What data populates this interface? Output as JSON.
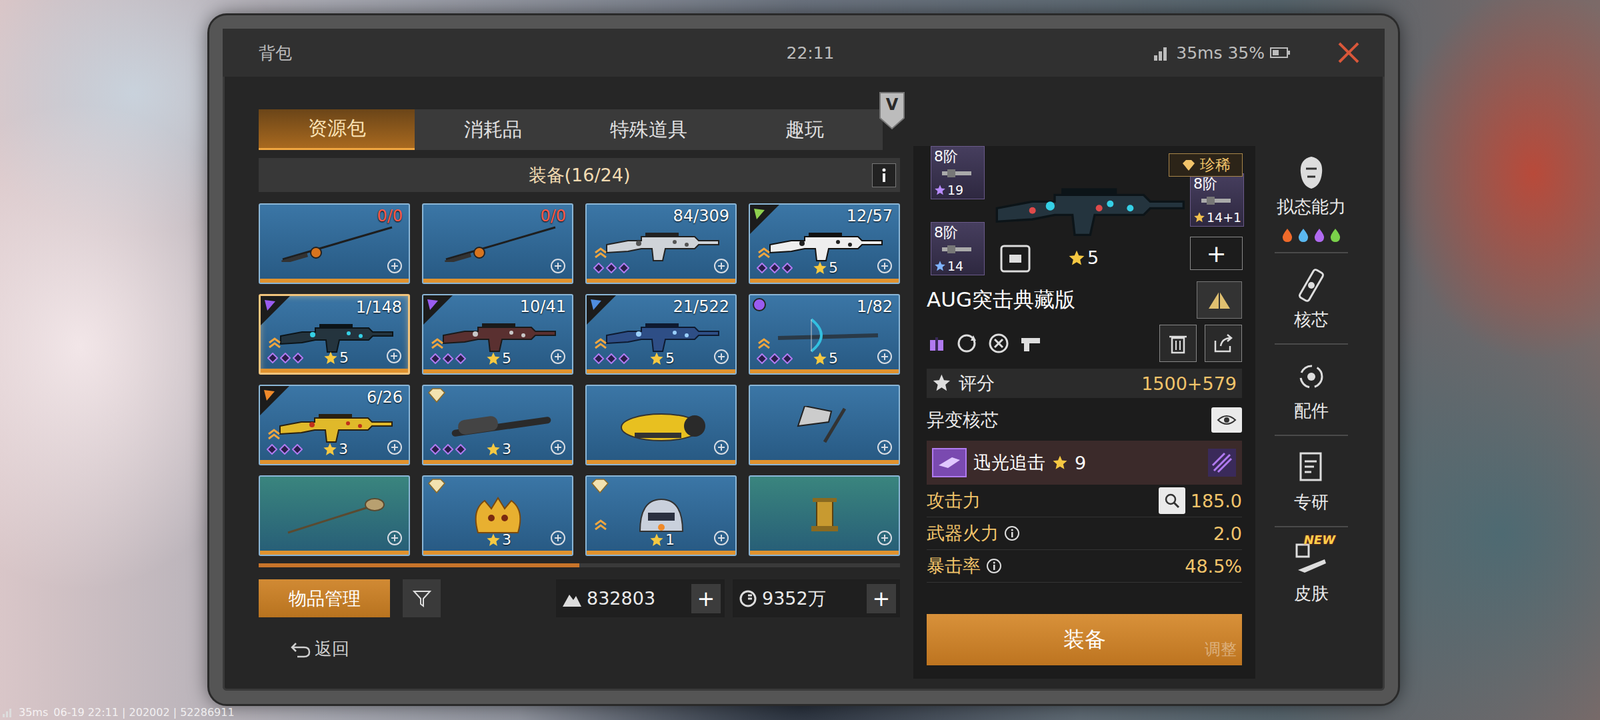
{
  "header": {
    "title": "背包",
    "time": "22:11",
    "ping": "35ms",
    "battery": "35%"
  },
  "tabs": [
    {
      "label": "资源包",
      "selected": true
    },
    {
      "label": "消耗品",
      "selected": false
    },
    {
      "label": "特殊道具",
      "selected": false
    },
    {
      "label": "趣玩",
      "selected": false
    }
  ],
  "vip_badge": "V",
  "section": {
    "title": "装备(16/24)"
  },
  "items": [
    {
      "kind": "rod",
      "count": "0/0",
      "depleted": true,
      "badge": null,
      "badge_color": null,
      "upgradable": false,
      "sockets": 0,
      "star_level": null,
      "level": 1,
      "selected": false,
      "color": "#3b76a6"
    },
    {
      "kind": "rod",
      "count": "0/0",
      "depleted": true,
      "badge": null,
      "badge_color": null,
      "upgradable": false,
      "sockets": 0,
      "star_level": null,
      "level": 1,
      "selected": false,
      "color": "#3b76a6"
    },
    {
      "kind": "smg",
      "count": "84/309",
      "depleted": false,
      "badge": null,
      "badge_color": null,
      "upgradable": true,
      "sockets": 3,
      "star_level": null,
      "level": 1,
      "selected": false,
      "color": "#3b76a6"
    },
    {
      "kind": "carbine",
      "count": "12/57",
      "depleted": false,
      "badge": "triangle",
      "badge_color": "#8fd14f",
      "upgradable": true,
      "sockets": 3,
      "star_level": "5",
      "level": 1,
      "selected": false,
      "color": "#3b76a6"
    },
    {
      "kind": "rifle",
      "count": "1/148",
      "depleted": false,
      "badge": "triangle",
      "badge_color": "#9a5cf0",
      "upgradable": true,
      "sockets": 3,
      "star_level": "5",
      "level": 1,
      "selected": true,
      "color": "#3b76a6"
    },
    {
      "kind": "sniper",
      "count": "10/41",
      "depleted": false,
      "badge": "triangle",
      "badge_color": "#9a5cf0",
      "upgradable": true,
      "sockets": 3,
      "star_level": "5",
      "level": 1,
      "selected": false,
      "color": "#3b76a6"
    },
    {
      "kind": "launcher",
      "count": "21/522",
      "depleted": false,
      "badge": "triangle",
      "badge_color": "#4f8de0",
      "upgradable": true,
      "sockets": 3,
      "star_level": "5",
      "level": 1,
      "selected": false,
      "color": "#3b76a6"
    },
    {
      "kind": "crossbow",
      "count": "1/82",
      "depleted": false,
      "badge": "orb",
      "badge_color": "#9a5cf0",
      "upgradable": true,
      "sockets": 3,
      "star_level": "5",
      "level": 1,
      "selected": false,
      "color": "#3b76a6"
    },
    {
      "kind": "cannon",
      "count": "6/26",
      "depleted": false,
      "badge": "triangle",
      "badge_color": "#f08a2a",
      "upgradable": true,
      "sockets": 3,
      "star_level": "3",
      "level": 1,
      "selected": false,
      "color": "#3b76a6"
    },
    {
      "kind": "bat",
      "count": null,
      "depleted": false,
      "badge": "diamond",
      "badge_color": "#f3e2b0",
      "upgradable": false,
      "sockets": 3,
      "star_level": "3",
      "level": 1,
      "selected": false,
      "color": "#3b76a6"
    },
    {
      "kind": "pod",
      "count": null,
      "depleted": false,
      "badge": null,
      "badge_color": null,
      "upgradable": false,
      "sockets": 0,
      "star_level": null,
      "level": 1,
      "selected": false,
      "color": "#3b76a6"
    },
    {
      "kind": "axe",
      "count": null,
      "depleted": false,
      "badge": null,
      "badge_color": null,
      "upgradable": false,
      "sockets": 0,
      "star_level": null,
      "level": 1,
      "selected": false,
      "color": "#3b76a6"
    },
    {
      "kind": "ladle",
      "count": null,
      "depleted": false,
      "badge": null,
      "badge_color": null,
      "upgradable": false,
      "sockets": 0,
      "star_level": null,
      "level": 1,
      "selected": false,
      "color": "#3a857e"
    },
    {
      "kind": "mask",
      "count": null,
      "depleted": false,
      "badge": "diamond",
      "badge_color": "#f3e2b0",
      "upgradable": false,
      "sockets": 0,
      "star_level": "3",
      "level": 1,
      "selected": false,
      "color": "#3b76a6"
    },
    {
      "kind": "helmet",
      "count": null,
      "depleted": false,
      "badge": "diamond",
      "badge_color": "#f3e2b0",
      "upgradable": true,
      "sockets": 0,
      "star_level": "1",
      "level": 1,
      "selected": false,
      "color": "#3b76a6"
    },
    {
      "kind": "pillar",
      "count": null,
      "depleted": false,
      "badge": null,
      "badge_color": null,
      "upgradable": false,
      "sockets": 0,
      "star_level": null,
      "level": 1,
      "selected": false,
      "color": "#3a857e"
    }
  ],
  "scroll": {
    "level": 0.5
  },
  "manage_button": "物品管理",
  "currencies": [
    {
      "value": "832803",
      "add": "+"
    },
    {
      "value": "9352万",
      "add": "+"
    }
  ],
  "back": "返回",
  "detail": {
    "attachments": [
      {
        "tier": "8阶",
        "rank": "19",
        "color": "#b88cff"
      },
      {
        "tier": "8阶",
        "rank": "14",
        "color": "#7fb3ff"
      },
      {
        "tier": "8阶",
        "rank": "14+1",
        "color": "#f2c14e"
      }
    ],
    "add_attachment": "+",
    "rarity": "珍稀",
    "star_level": "5",
    "name": "AUG突击典藏版",
    "score": {
      "label": "评分",
      "value": "1500+579"
    },
    "core_section": "异变核芯",
    "core": {
      "name": "迅光追击",
      "level": "9"
    },
    "stats": [
      {
        "label": "攻击力",
        "value": "185.0",
        "info": false,
        "magnifier": true
      },
      {
        "label": "武器火力",
        "value": "2.0",
        "info": true,
        "magnifier": false
      },
      {
        "label": "暴击率",
        "value": "48.5%",
        "info": true,
        "magnifier": false
      }
    ],
    "equip_button": "装备",
    "hint": "调整"
  },
  "sidebar": {
    "items": [
      {
        "label": "拟态能力",
        "badge": null
      },
      {
        "label": "核芯",
        "badge": null
      },
      {
        "label": "配件",
        "badge": null
      },
      {
        "label": "专研",
        "badge": null
      },
      {
        "label": "皮肤",
        "badge": "NEW"
      }
    ],
    "elements": [
      {
        "color": "#f06a2a"
      },
      {
        "color": "#5ab8f0"
      },
      {
        "color": "#b06af0"
      },
      {
        "color": "#7ad04a"
      }
    ]
  },
  "debug": {
    "ping": "35ms",
    "info": "06-19 22:11 | 202002 | 52286911"
  }
}
